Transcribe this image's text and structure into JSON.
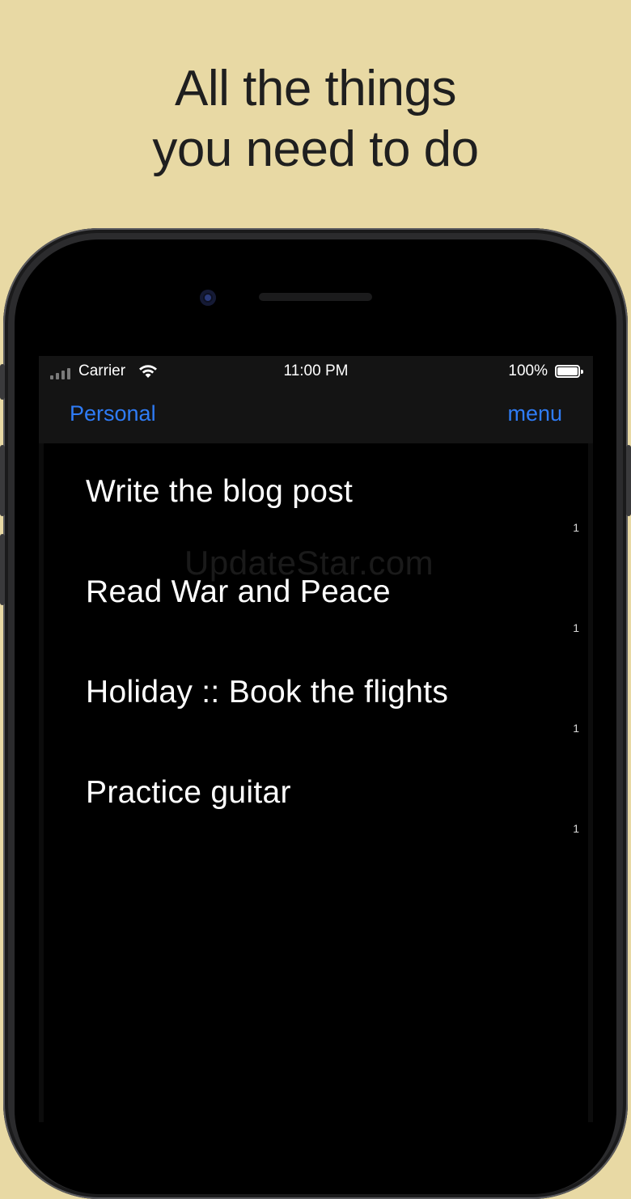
{
  "headline": {
    "line1": "All the things",
    "line2": "you need to do"
  },
  "status_bar": {
    "carrier": "Carrier",
    "time": "11:00 PM",
    "battery": "100%"
  },
  "nav": {
    "left_label": "Personal",
    "right_label": "menu",
    "accent_color": "#2f7cf6"
  },
  "tasks": [
    {
      "title": "Write the blog post",
      "count": "1"
    },
    {
      "title": "Read War and Peace",
      "count": "1"
    },
    {
      "title": "Holiday :: Book the flights",
      "count": "1"
    },
    {
      "title": "Practice guitar",
      "count": "1"
    }
  ],
  "watermark": "UpdateStar.com",
  "colors": {
    "background": "#e8d9a4",
    "screen": "#000000",
    "bar": "#141414"
  }
}
